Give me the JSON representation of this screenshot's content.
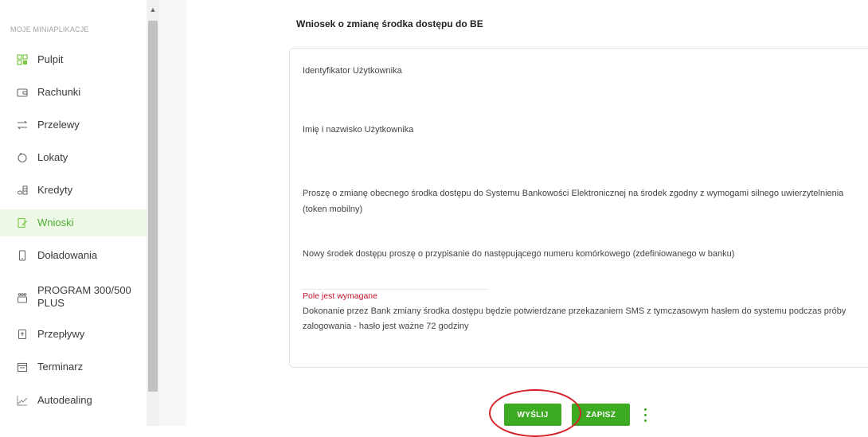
{
  "sidebar": {
    "header": "MOJE MINIAPLIKACJE",
    "items": [
      {
        "label": "Pulpit",
        "icon": "dashboard-icon"
      },
      {
        "label": "Rachunki",
        "icon": "wallet-icon"
      },
      {
        "label": "Przelewy",
        "icon": "transfer-arrows-icon"
      },
      {
        "label": "Lokaty",
        "icon": "piggy-bank-icon"
      },
      {
        "label": "Kredyty",
        "icon": "coins-icon"
      },
      {
        "label": "Wnioski",
        "icon": "document-edit-icon"
      },
      {
        "label": "Doładowania",
        "icon": "phone-icon"
      },
      {
        "label": "PROGRAM 300/500",
        "label2": "PLUS",
        "icon": "family-icon"
      },
      {
        "label": "Przepływy",
        "icon": "flow-document-icon"
      },
      {
        "label": "Terminarz",
        "icon": "calendar-icon"
      },
      {
        "label": "Autodealing",
        "icon": "chart-line-icon"
      }
    ],
    "active": "Wnioski"
  },
  "main": {
    "title": "Wniosek o zmianę środka dostępu do BE",
    "fields": {
      "user_id_label": "Identyfikator Użytkownika",
      "user_name_label": "Imię i nazwisko Użytkownika",
      "request_text": "Proszę o zmianę obecnego środka dostępu do Systemu Bankowości Elektronicznej na środek zgodny z wymogami silnego uwierzytelnienia (token mobilny)",
      "phone_text": "Nowy środek dostępu proszę o przypisanie do następującego numeru komórkowego (zdefiniowanego w banku)",
      "error_text": "Pole jest wymagane",
      "note_text": "Dokonanie przez Bank zmiany środka dostępu będzie potwierdzane przekazaniem SMS z tymczasowym hasłem do systemu podczas próby zalogowania - hasło jest ważne 72 godziny"
    },
    "buttons": {
      "send": "WYŚLIJ",
      "save": "ZAPISZ"
    }
  },
  "colors": {
    "accent_green": "#3cab22",
    "active_bg": "#eef8e6",
    "error_red": "#c0102a",
    "annotation_red": "#d6242a"
  }
}
